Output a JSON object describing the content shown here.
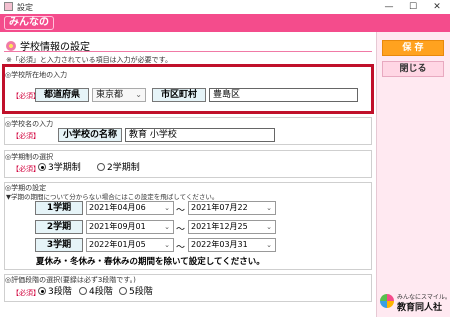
{
  "window": {
    "title": "設定",
    "minimize": "—",
    "maximize": "☐",
    "close": "✕"
  },
  "banner": {
    "logo": "みんなの"
  },
  "section": {
    "title": "学校情報の設定",
    "note": "※「必須」と入力されている項目は入力が必要です。"
  },
  "address": {
    "group_title": "◎学校所在地の入力",
    "required": "【必須】",
    "prefecture_label": "都道府県",
    "prefecture_value": "東京都",
    "city_label": "市区町村",
    "city_value": "豊島区"
  },
  "school_name": {
    "group_title": "◎学校名の入力",
    "required": "【必須】",
    "label": "小学校の名称",
    "value": "教育 小学校"
  },
  "term_system": {
    "group_title": "◎学期制の選択",
    "required": "【必須】",
    "options": [
      "3学期制",
      "2学期制"
    ],
    "selected": "3学期制"
  },
  "term_dates": {
    "group_title": "◎学期の設定",
    "instruction": "▼学期の期間について分からない場合にはこの設定を飛ばしてください。",
    "rows": [
      {
        "label": "1学期",
        "start": "2021年04月06",
        "end": "2021年07月22"
      },
      {
        "label": "2学期",
        "start": "2021年09月01",
        "end": "2021年12月25"
      },
      {
        "label": "3学期",
        "start": "2022年01月05",
        "end": "2022年03月31"
      }
    ],
    "tilde": "〜",
    "footer_note": "夏休み・冬休み・春休みの期間を除いて設定してください。"
  },
  "evaluation": {
    "group_title": "◎評価段階の選択(要録は必ず3段階です。)",
    "required": "【必須】",
    "options": [
      "3段階",
      "4段階",
      "5段階"
    ],
    "selected": "3段階"
  },
  "buttons": {
    "save": "保 存",
    "close": "閉じる"
  },
  "brand": {
    "tagline": "みんなにスマイル。",
    "name": "教育同人社"
  },
  "colors": {
    "accent": "#f44c8c",
    "save": "#ffa21f",
    "highlight": "#c0102a",
    "required": "#d2003c"
  }
}
